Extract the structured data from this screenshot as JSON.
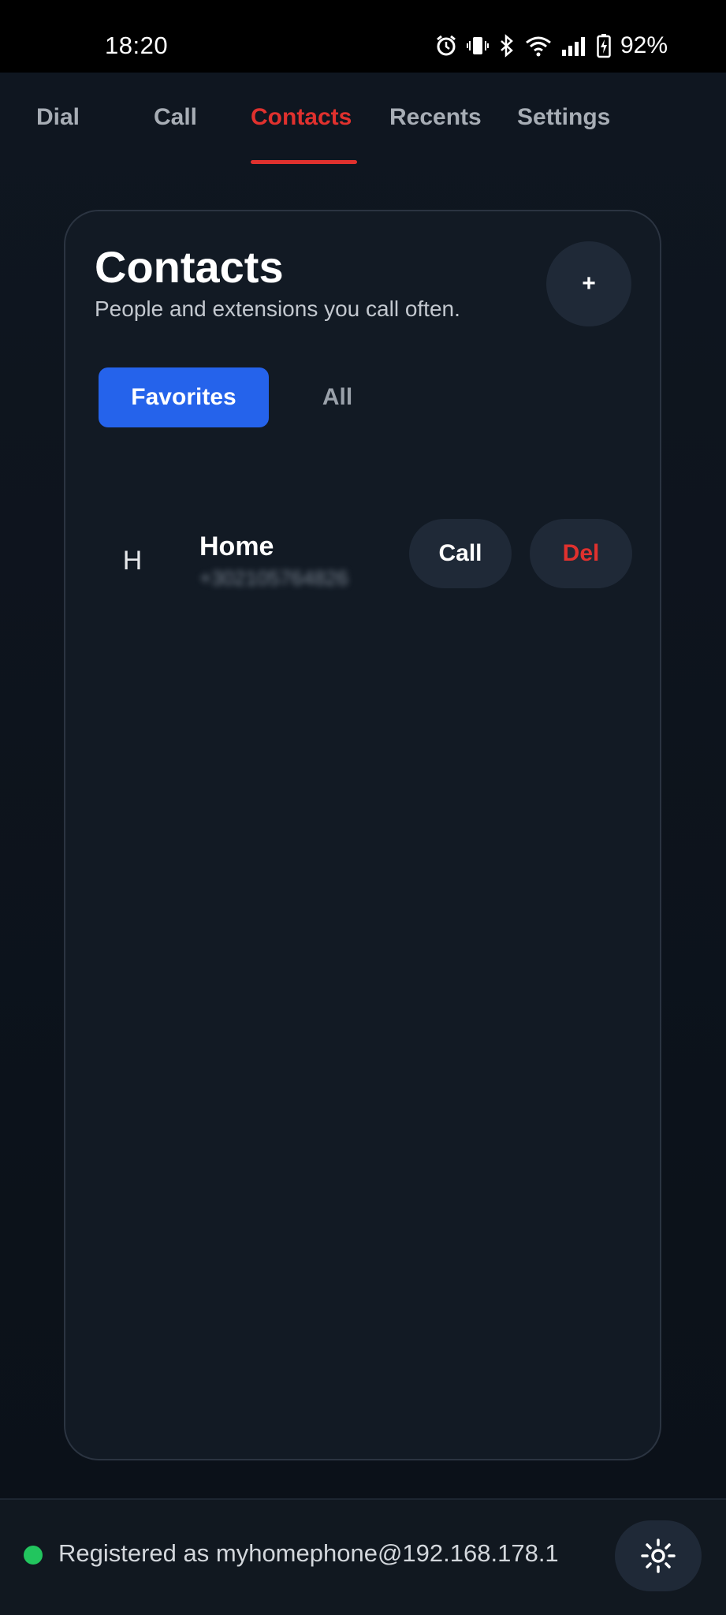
{
  "status_bar": {
    "time": "18:20",
    "battery": "92%",
    "icons": [
      "alarm-icon",
      "vibrate-icon",
      "bluetooth-icon",
      "wifi-icon",
      "signal-icon",
      "battery-charging-icon"
    ]
  },
  "tabs": [
    {
      "label": "Dial",
      "active": false
    },
    {
      "label": "Call",
      "active": false
    },
    {
      "label": "Contacts",
      "active": true
    },
    {
      "label": "Recents",
      "active": false
    },
    {
      "label": "Settings",
      "active": false
    }
  ],
  "card": {
    "title": "Contacts",
    "subtitle": "People and extensions you call often.",
    "add_label": "+",
    "segments": {
      "favorites": "Favorites",
      "all": "All",
      "selected": "Favorites"
    },
    "contacts": [
      {
        "initial": "H",
        "name": "Home",
        "number": "+302105764826",
        "call_label": "Call",
        "delete_label": "Del"
      }
    ]
  },
  "footer": {
    "status_text": "Registered as myhomephone@192.168.178.1",
    "status_color": "#22c55e",
    "theme_icon": "sun-icon"
  },
  "colors": {
    "accent_red": "#e0312e",
    "primary_blue": "#2563eb",
    "surface": "#121a24",
    "pill_bg": "#1f2937"
  }
}
